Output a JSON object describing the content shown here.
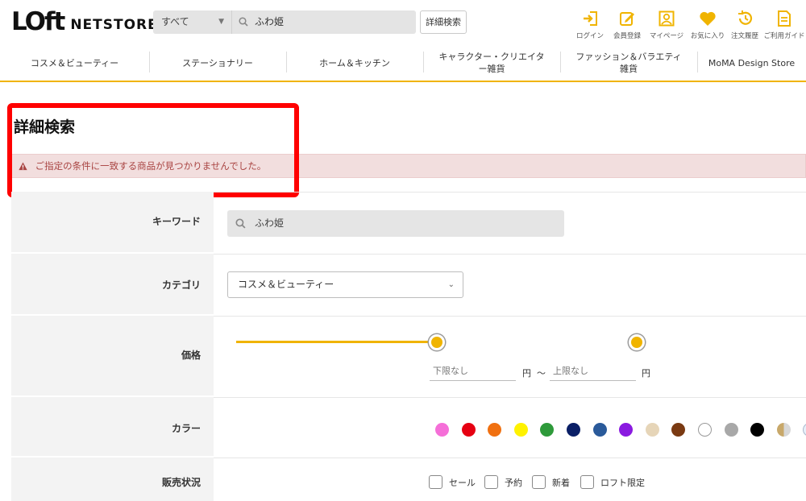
{
  "header": {
    "logo_mark": "LOft",
    "logo_text": "NETSTORE",
    "search": {
      "category": "すべて",
      "query": "ふわ姫"
    },
    "advanced_button": "詳細検索",
    "utilities": [
      {
        "label": "ログイン",
        "icon": "login-icon"
      },
      {
        "label": "会員登録",
        "icon": "register-icon"
      },
      {
        "label": "マイページ",
        "icon": "mypage-icon"
      },
      {
        "label": "お気に入り",
        "icon": "heart-icon"
      },
      {
        "label": "注文履歴",
        "icon": "history-icon"
      },
      {
        "label": "ご利用ガイド",
        "icon": "guide-icon"
      }
    ],
    "accent_color": "#f0b400"
  },
  "categories": [
    "コスメ＆ビューティー",
    "ステーショナリー",
    "ホーム＆キッチン",
    "キャラクター・クリエイター雑貨",
    "ファッション＆バラエティ雑貨",
    "MoMA Design Store"
  ],
  "page": {
    "title": "詳細検索",
    "alert": "ご指定の条件に一致する商品が見つかりませんでした。"
  },
  "form": {
    "keyword": {
      "label": "キーワード",
      "value": "ふわ姫"
    },
    "category": {
      "label": "カテゴリ",
      "value": "コスメ＆ビューティー"
    },
    "price": {
      "label": "価格",
      "min_placeholder": "下限なし",
      "max_placeholder": "上限なし",
      "unit": "円",
      "sep": "〜"
    },
    "color": {
      "label": "カラー",
      "swatches": [
        "#f56fd8",
        "#e60012",
        "#f07010",
        "#fff200",
        "#2e9a3a",
        "#0a1f66",
        "#2a5a9a",
        "#8a1ae0",
        "#e6d5b8",
        "#7a3a12",
        "#ffffff",
        "#a8a8a8",
        "#000000",
        "gold-silver",
        "clear",
        "multi"
      ]
    },
    "status": {
      "label": "販売状況",
      "options": [
        "セール",
        "予約",
        "新着",
        "ロフト限定"
      ]
    }
  }
}
